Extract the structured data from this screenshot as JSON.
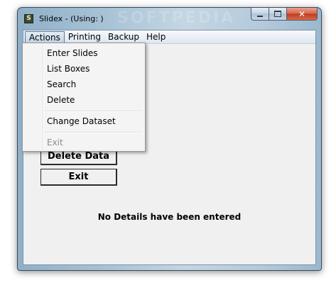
{
  "window": {
    "title": "Slidex - (Using: )",
    "icon_name": "slidex-app-icon",
    "icon_glyph": "S"
  },
  "controls": {
    "minimize": "minimize-icon",
    "maximize": "maximize-icon",
    "close": "close-icon",
    "close_glyph": "✕"
  },
  "menubar": {
    "items": [
      {
        "label": "Actions"
      },
      {
        "label": "Printing"
      },
      {
        "label": "Backup"
      },
      {
        "label": "Help"
      }
    ]
  },
  "actions_menu": {
    "items": [
      {
        "label": "Enter Slides",
        "enabled": true
      },
      {
        "label": "List Boxes",
        "enabled": true
      },
      {
        "label": "Search",
        "enabled": true
      },
      {
        "label": "Delete",
        "enabled": true
      },
      {
        "label": "Change Dataset",
        "enabled": true
      },
      {
        "label": "Exit",
        "enabled": false
      }
    ]
  },
  "form": {
    "delete_button": "Delete Data",
    "exit_button": "Exit",
    "status_message": "No Details have been entered"
  },
  "colors": {
    "close_button": "#c0391b",
    "titlebar": "#a9c3d6",
    "client_background": "#f0f0f0"
  }
}
